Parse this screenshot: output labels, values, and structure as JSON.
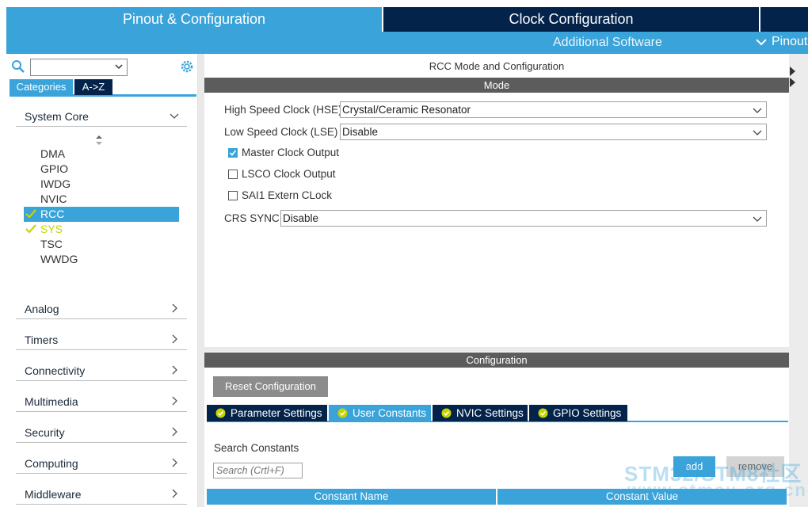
{
  "top_tabs": {
    "pinout": "Pinout & Configuration",
    "clock": "Clock Configuration"
  },
  "sub_bar": {
    "additional": "Additional Software",
    "pinout": "Pinout"
  },
  "sidebar": {
    "search_value": "",
    "tabs": {
      "categories": "Categories",
      "az": "A->Z"
    },
    "system_core": "System Core",
    "sys_items": [
      "DMA",
      "GPIO",
      "IWDG",
      "NVIC",
      "RCC",
      "SYS",
      "TSC",
      "WWDG"
    ],
    "groups": [
      "Analog",
      "Timers",
      "Connectivity",
      "Multimedia",
      "Security",
      "Computing",
      "Middleware"
    ]
  },
  "mode_panel": {
    "title": "RCC Mode and Configuration",
    "mode_header": "Mode",
    "hse_label": "High Speed Clock (HSE)",
    "hse_value": "Crystal/Ceramic Resonator",
    "lse_label": "Low Speed Clock (LSE)",
    "lse_value": "Disable",
    "mco": "Master Clock Output",
    "lsco": "LSCO Clock Output",
    "sai1": "SAI1 Extern CLock",
    "crs_label": "CRS SYNC",
    "crs_value": "Disable"
  },
  "config_panel": {
    "header": "Configuration",
    "reset": "Reset Configuration",
    "tabs": [
      "Parameter Settings",
      "User Constants",
      "NVIC Settings",
      "GPIO Settings"
    ],
    "search_label": "Search Constants",
    "search_placeholder": "Search (Crtl+F)",
    "add": "add",
    "remove": "remove",
    "col_name": "Constant Name",
    "col_value": "Constant Value"
  },
  "watermark": {
    "line1": "STM32/STM8社区",
    "line2": "www.stmcu.org.cn"
  },
  "colors": {
    "accent": "#3aa3d9",
    "navy": "#03234b",
    "header_gray": "#5c5c5c",
    "check_yellow": "#c8d400"
  },
  "checkbox_state": {
    "mco": true,
    "lsco": false,
    "sai1": false
  }
}
